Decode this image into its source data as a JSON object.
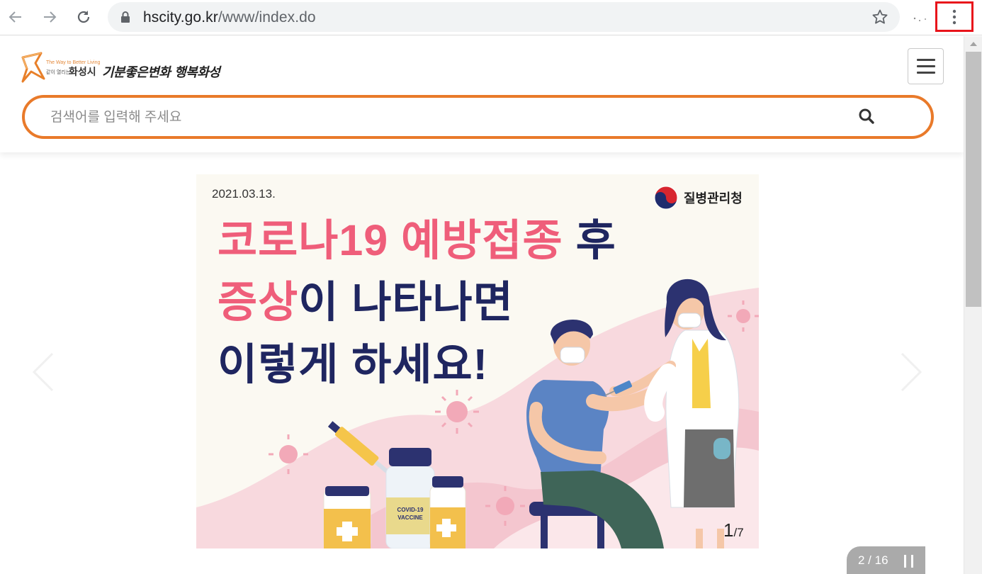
{
  "browser": {
    "url_host": "hscity.go.kr",
    "url_path": "/www/index.do",
    "icons": [
      "back-icon",
      "forward-icon",
      "reload-icon",
      "lock-icon",
      "bookmark-star-icon",
      "more-vert-icon"
    ]
  },
  "site": {
    "logo_tagline": "The Way to Better Living",
    "logo_city_small": "같이 열리는",
    "logo_city": "화성시",
    "logo_slogan": "기분좋은변화 행복화성",
    "menu_icon": "hamburger-icon",
    "search": {
      "placeholder": "검색어를 입력해 주세요",
      "value": "",
      "icon": "search-icon"
    }
  },
  "carousel": {
    "slide": {
      "date": "2021.03.13.",
      "agency": "질병관리청",
      "headline_line1_pink": "코로나19 예방접종",
      "headline_line1_navy": " 후",
      "headline_line2_pink": "증상",
      "headline_line2_navy": "이 나타나면",
      "headline_line3": "이렇게 하세요!",
      "vaccine_label_1": "COVID-19",
      "vaccine_label_2": "VACCINE",
      "page_current": "1",
      "page_total": "/7"
    },
    "pager_text": "2 / 16",
    "colors": {
      "accent_pink": "#ef5e7a",
      "accent_navy": "#1f2660",
      "search_border": "#e97a2a"
    }
  }
}
